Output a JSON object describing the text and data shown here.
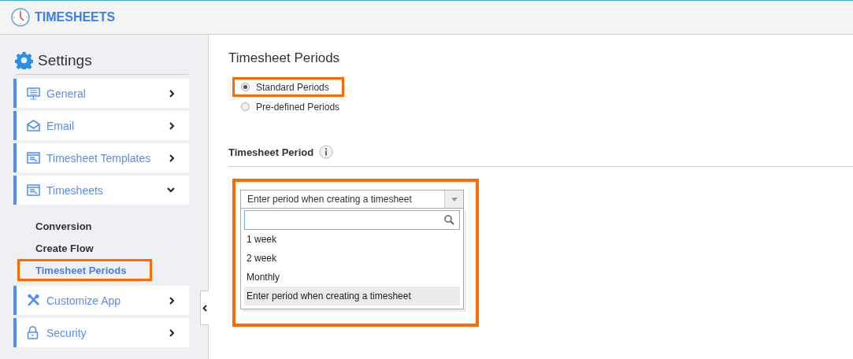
{
  "app": {
    "title": "TIMESHEETS"
  },
  "sidebar": {
    "title": "Settings",
    "items": [
      {
        "label": "General",
        "expanded": false
      },
      {
        "label": "Email",
        "expanded": false
      },
      {
        "label": "Timesheet Templates",
        "expanded": false
      },
      {
        "label": "Timesheets",
        "expanded": true,
        "children": [
          {
            "label": "Conversion",
            "selected": false,
            "highlighted": false
          },
          {
            "label": "Create Flow",
            "selected": false,
            "highlighted": false
          },
          {
            "label": "Timesheet Periods",
            "selected": true,
            "highlighted": true
          }
        ]
      },
      {
        "label": "Customize App",
        "expanded": false
      },
      {
        "label": "Security",
        "expanded": false
      }
    ]
  },
  "main": {
    "title": "Timesheet Periods",
    "radios": [
      {
        "label": "Standard Periods",
        "selected": true,
        "highlighted": true
      },
      {
        "label": "Pre-defined Periods",
        "selected": false,
        "highlighted": false
      }
    ],
    "section": "Timesheet Period",
    "dropdown": {
      "value": "Enter period when creating a timesheet",
      "expanded": true,
      "highlighted": true,
      "options": [
        {
          "label": "1 week",
          "selected": false
        },
        {
          "label": "2 week",
          "selected": false
        },
        {
          "label": "Monthly",
          "selected": false
        },
        {
          "label": "Enter period when creating a timesheet",
          "selected": true
        }
      ]
    }
  }
}
